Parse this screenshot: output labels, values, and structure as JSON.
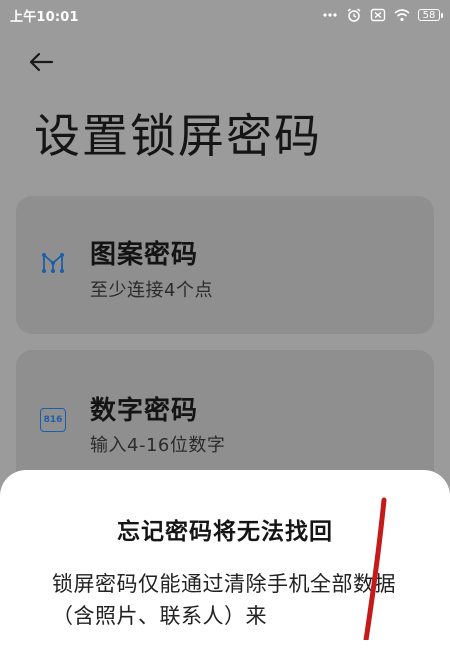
{
  "status_bar": {
    "time": "上午10:01",
    "icons": [
      "more-dots-icon",
      "alarm-icon",
      "sim-off-icon",
      "wifi-icon"
    ],
    "battery": "58"
  },
  "header": {
    "back_icon": "back-arrow-icon",
    "title": "设置锁屏密码"
  },
  "options": [
    {
      "icon": "pattern-icon",
      "title": "图案密码",
      "subtitle": "至少连接4个点"
    },
    {
      "icon": "number-pad-icon",
      "icon_text": "816",
      "title": "数字密码",
      "subtitle": "输入4-16位数字"
    }
  ],
  "dialog": {
    "title": "忘记密码将无法找回",
    "body": "锁屏密码仅能通过清除手机全部数据（含照片、联系人）来"
  },
  "colors": {
    "dim_background": "#9b9b9b",
    "card": "#8f8f8f",
    "accent_blue": "#1d5ea8",
    "sheet": "#ffffff",
    "annotation_red": "#c41a1a"
  }
}
